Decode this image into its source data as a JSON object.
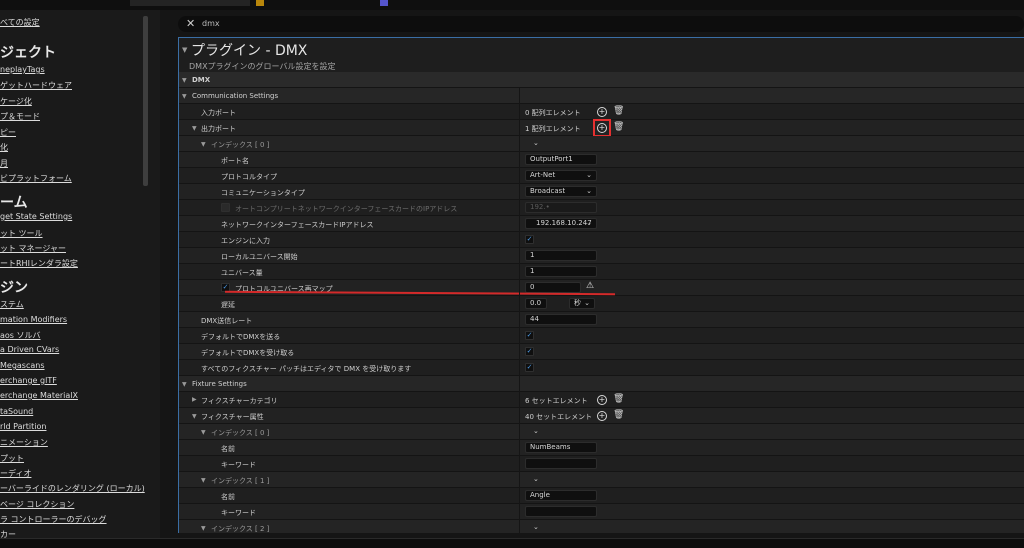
{
  "search": {
    "query": "dmx"
  },
  "sidebar": {
    "items": [
      {
        "type": "item",
        "label": "べての設定"
      },
      {
        "type": "head",
        "label": "ジェクト"
      },
      {
        "type": "item",
        "label": "neplayTags"
      },
      {
        "type": "item",
        "label": "ゲットハードウェア"
      },
      {
        "type": "item",
        "label": "ケージ化"
      },
      {
        "type": "item",
        "label": "プ＆モード"
      },
      {
        "type": "item",
        "label": "ピー"
      },
      {
        "type": "item",
        "label": "化"
      },
      {
        "type": "item",
        "label": "月"
      },
      {
        "type": "item",
        "label": "ビプラットフォーム"
      },
      {
        "type": "head",
        "label": "ーム"
      },
      {
        "type": "item",
        "label": "get State Settings"
      },
      {
        "type": "item",
        "label": "ット ツール"
      },
      {
        "type": "item",
        "label": "ット マネージャー"
      },
      {
        "type": "item",
        "label": "ートRHIレンダラ設定"
      },
      {
        "type": "head",
        "label": "ジン"
      },
      {
        "type": "item",
        "label": "ステム"
      },
      {
        "type": "item",
        "label": "mation Modifiers"
      },
      {
        "type": "item",
        "label": "aos ソルバ"
      },
      {
        "type": "item",
        "label": "a Driven CVars"
      },
      {
        "type": "item",
        "label": "Megascans"
      },
      {
        "type": "item",
        "label": "erchange glTF"
      },
      {
        "type": "item",
        "label": "erchange MaterialX"
      },
      {
        "type": "item",
        "label": "taSound"
      },
      {
        "type": "item",
        "label": "rld Partition"
      },
      {
        "type": "item",
        "label": "ニメーション"
      },
      {
        "type": "item",
        "label": "プット"
      },
      {
        "type": "item",
        "label": "ーディオ"
      },
      {
        "type": "item",
        "label": "ーバーライドのレンダリング (ローカル)"
      },
      {
        "type": "item",
        "label": "ベージ コレクション"
      },
      {
        "type": "item",
        "label": "ラ コントローラーのデバッグ"
      },
      {
        "type": "item",
        "label": "カー"
      }
    ]
  },
  "panel": {
    "title": "プラグイン - DMX",
    "subtitle": "DMXプラグインのグローバル設定を設定",
    "sections": {
      "dmx": "DMX",
      "communication": "Communication Settings",
      "fixture": "Fixture Settings"
    },
    "rows": {
      "input_ports": {
        "label": "入力ポート",
        "value": "0 配列エレメント"
      },
      "output_ports": {
        "label": "出力ポート",
        "value": "1 配列エレメント"
      },
      "index0": {
        "label": "インデックス [ 0 ]"
      },
      "port_name": {
        "label": "ポート名",
        "value": "OutputPort1"
      },
      "protocol_type": {
        "label": "プロトコルタイプ",
        "value": "Art-Net"
      },
      "comm_type": {
        "label": "コミュニケーションタイプ",
        "value": "Broadcast"
      },
      "auto_complete": {
        "label": "オートコンプリートネットワークインターフェースカードのIPアドレス",
        "value": "192.•"
      },
      "nic_ip": {
        "label": "ネットワークインターフェースカードIPアドレス",
        "value": "192.168.10.247"
      },
      "input_to_engine": {
        "label": "エンジンに入力"
      },
      "local_universe_start": {
        "label": "ローカルユニバース開始",
        "value": "1"
      },
      "universe_count": {
        "label": "ユニバース量",
        "value": "1"
      },
      "protocol_remap": {
        "label": "プロトコルユニバース再マップ",
        "value": "0"
      },
      "delay": {
        "label": "遅延",
        "value": "0.0",
        "unit": "秒"
      },
      "send_rate": {
        "label": "DMX送信レート",
        "value": "44"
      },
      "default_send": {
        "label": "デフォルトでDMXを送る"
      },
      "default_receive": {
        "label": "デフォルトでDMXを受け取る"
      },
      "receive_in_editor": {
        "label": "すべてのフィクスチャー パッチはエディタで DMX を受け取ります"
      },
      "fixture_categories": {
        "label": "フィクスチャーカテゴリ",
        "value": "6 セットエレメント"
      },
      "fixture_attributes": {
        "label": "フィクスチャー属性",
        "value": "40 セットエレメント"
      },
      "attr_index0": {
        "label": "インデックス [ 0 ]"
      },
      "attr0_name": {
        "label": "名前",
        "value": "NumBeams"
      },
      "attr0_keyword": {
        "label": "キーワード",
        "value": ""
      },
      "attr_index1": {
        "label": "インデックス [ 1 ]"
      },
      "attr1_name": {
        "label": "名前",
        "value": "Angle"
      },
      "attr1_keyword": {
        "label": "キーワード",
        "value": ""
      },
      "attr_index2": {
        "label": "インデックス [ 2 ]"
      }
    }
  },
  "colors": {
    "highlight_box": "#e53030",
    "annotation_line": "#d42a2a",
    "checkbox": "#4c9be8",
    "panel_border": "#3a6ea5"
  },
  "icons": {
    "add": "plus-circle-icon",
    "delete": "trash-icon",
    "warning": "warning-icon",
    "close": "close-icon"
  }
}
